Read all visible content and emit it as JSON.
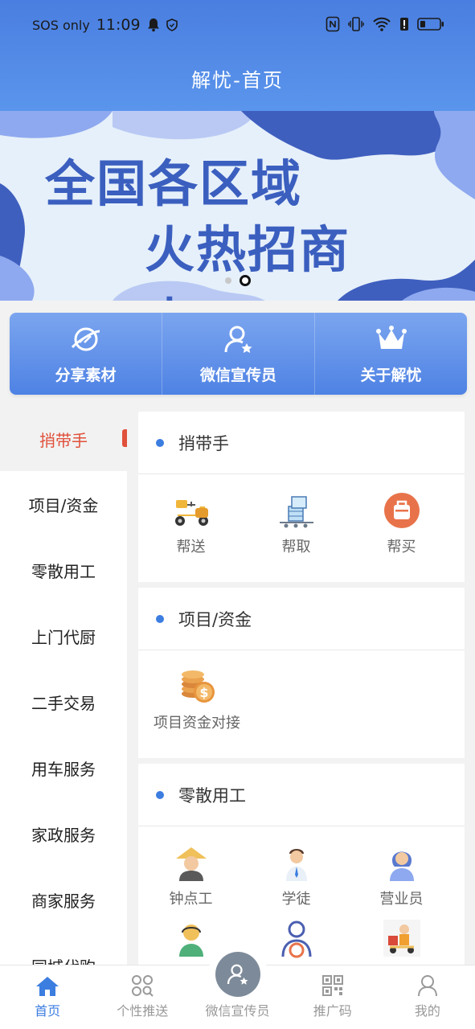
{
  "status": {
    "carrier": "SOS only",
    "time": "11:09"
  },
  "header": {
    "title": "解忧-首页"
  },
  "banner": {
    "line1": "全国各区域",
    "line2": "火热招商中！！",
    "dots": 2,
    "active_dot": 2
  },
  "quick_actions": [
    {
      "label": "分享素材",
      "icon": "planet-icon"
    },
    {
      "label": "微信宣传员",
      "icon": "user-star-icon"
    },
    {
      "label": "关于解忧",
      "icon": "crown-icon"
    }
  ],
  "side_nav": {
    "active": "捎带手",
    "items": [
      "捎带手",
      "项目/资金",
      "零散用工",
      "上门代厨",
      "二手交易",
      "用车服务",
      "家政服务",
      "商家服务",
      "同城代购"
    ]
  },
  "sections": [
    {
      "title": "捎带手",
      "items": [
        {
          "label": "帮送",
          "icon": "scooter-icon"
        },
        {
          "label": "帮取",
          "icon": "cart-boxes-icon"
        },
        {
          "label": "帮买",
          "icon": "bag-icon"
        }
      ]
    },
    {
      "title": "项目/资金",
      "items": [
        {
          "label": "项目资金对接",
          "icon": "coins-icon"
        }
      ]
    },
    {
      "title": "零散用工",
      "items": [
        {
          "label": "钟点工",
          "icon": "worker-icon"
        },
        {
          "label": "学徒",
          "icon": "apprentice-icon"
        },
        {
          "label": "营业员",
          "icon": "clerk-icon"
        },
        {
          "label": "",
          "icon": "headset-agent-icon"
        },
        {
          "label": "",
          "icon": "driver-icon"
        },
        {
          "label": "",
          "icon": "courier-icon"
        }
      ]
    }
  ],
  "tab_bar": {
    "active": "首页",
    "items": [
      {
        "label": "首页",
        "icon": "home-icon"
      },
      {
        "label": "个性推送",
        "icon": "grid-search-icon"
      },
      {
        "label": "微信宣传员",
        "icon": "user-star-icon"
      },
      {
        "label": "推广码",
        "icon": "qr-code-icon"
      },
      {
        "label": "我的",
        "icon": "person-icon"
      }
    ]
  },
  "colors": {
    "primary": "#4a7ee0",
    "accent_red": "#e0503a",
    "banner_text": "#3b5fbf"
  }
}
